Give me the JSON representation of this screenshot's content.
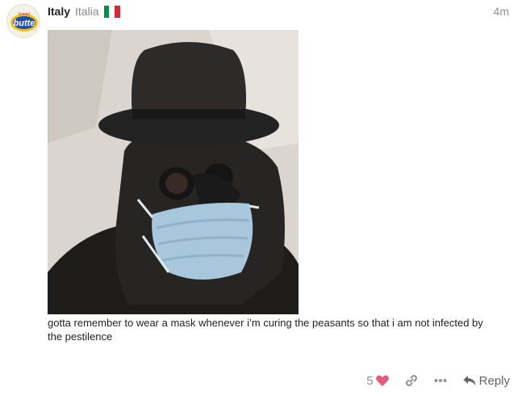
{
  "post": {
    "username": "Italy",
    "full_name": "Italia",
    "flag": {
      "name": "italy-flag-icon",
      "colors": [
        "#009246",
        "#ffffff",
        "#ce2b37"
      ]
    },
    "date": "4m",
    "avatar": {
      "name": "avatar",
      "brand_text": "butte"
    },
    "image": {
      "name": "post-image"
    },
    "text": "gotta remember to wear a mask whenever i’m curing the peasants so that i am not infected by the pestilence"
  },
  "controls": {
    "like_count": "5",
    "like_icon": "heart-icon",
    "link_icon": "link-icon",
    "more_icon": "more-icon",
    "reply_icon": "reply-icon",
    "reply_label": "Reply"
  },
  "colors": {
    "heart": "#e45d7e",
    "muted": "#919191"
  }
}
